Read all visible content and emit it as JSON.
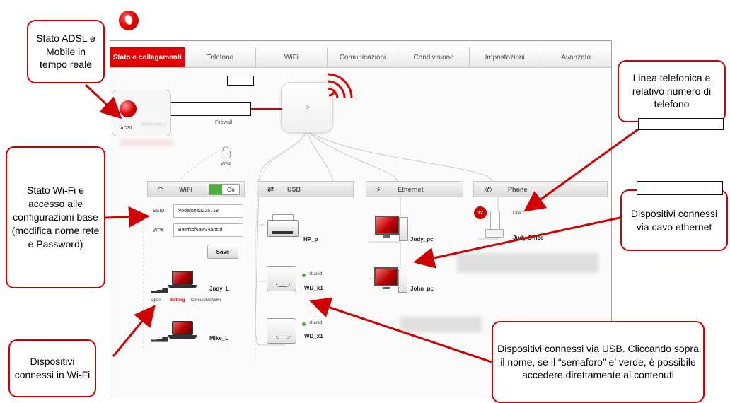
{
  "brand": {
    "logo_icon": "vodafone-logo-icon",
    "accent": "#e50000"
  },
  "tabs": [
    {
      "label": "Stato e collegamenti",
      "active": true
    },
    {
      "label": "Telefono"
    },
    {
      "label": "WiFi"
    },
    {
      "label": "Comunicazioni"
    },
    {
      "label": "Condivisione"
    },
    {
      "label": "Impostazioni"
    },
    {
      "label": "Avanzato"
    }
  ],
  "connections": {
    "adsl_label": "ADSL",
    "internet_key_label": "InternetKey",
    "firewall_label": "Firewall",
    "wpa_label": "WPA"
  },
  "wifi": {
    "title": "WiFi",
    "toggle_label": "On",
    "ssid_label": "SSID",
    "ssid_value": "Vodafone2225718",
    "wpa_label": "WPA",
    "wpa_value": "Bewfsdf6aw34ahsid",
    "save_label": "Save"
  },
  "devices": {
    "judy_l": "Judy_L",
    "open_label": "Open",
    "setting_label": "Setting",
    "connect_label": "ConnectviaWiFi",
    "mike_l": "Mike_L"
  },
  "usb": {
    "title": "USB",
    "printer": "HP_p",
    "drive1": "WD_x1",
    "drive2": "WD_x1",
    "shared": "shared"
  },
  "ethernet": {
    "title": "Ethernet",
    "judy_pc": "Judy_pc",
    "john_pc": "John_pc"
  },
  "phone": {
    "title": "Phone",
    "line": "Line 1",
    "device": "Judy Office",
    "badge": "12"
  },
  "callouts": {
    "adsl": "Stato ADSL e Mobile in tempo reale",
    "wifi": "Stato Wi-Fi e accesso alle configurazioni base (modifica nome rete e Password)",
    "devices_wifi": "Dispositivi connessi in Wi-Fi",
    "phone": "Linea telefonica e relativo numero di telefono",
    "ethernet": "Dispositivi connessi via cavo ethernet",
    "usb": "Dispositivi connessi via USB. Cliccando sopra il nome, se il “semaforo” e’ verde, è possibile accedere direttamente ai contenuti"
  }
}
